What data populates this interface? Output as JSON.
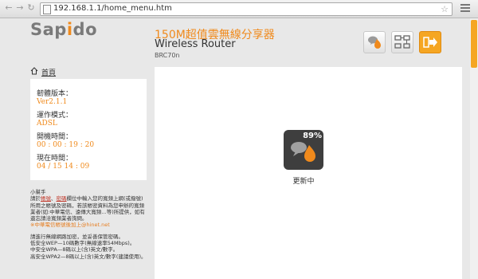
{
  "browser": {
    "url": "192.168.1.1/home_menu.htm",
    "icons": [
      "back-arrow-icon",
      "forward-arrow-icon",
      "reload-icon",
      "page-icon",
      "star-icon",
      "menu-icon"
    ]
  },
  "header": {
    "logo": {
      "pre": "Sap",
      "o": "i",
      "post": "do"
    },
    "product_zh": "150M超值雲無線分享器",
    "product_en": "Wireless Router",
    "model": "BRC70n",
    "accent": "#f08a1c"
  },
  "sidebar": {
    "home_label": "首頁",
    "info": [
      {
        "label": "韌體版本：",
        "value": "Ver2.1.1"
      },
      {
        "label": "運作模式：",
        "value": "ADSL"
      },
      {
        "label": "開機時間：",
        "value": "00 : 00 : 19 : 20"
      },
      {
        "label": "現在時間：",
        "value": "04 / 15  14 : 09"
      }
    ]
  },
  "help": {
    "title": "小幫手",
    "l1_a": "請於",
    "l1_acc": "帳號",
    "l1_b": "、",
    "l1_pwd": "密碼",
    "l1_c": "欄位中輸入您的寬頻上網(或撥號)",
    "l2": "所用之帳號及密碼，若該帳密資料為您申辦的寬頻",
    "l3": "業者(如:中華電信、遠傳大寬頻…等)所提供，如有",
    "l4": "遺忘請洽寬頻業者詢問。",
    "l5": "※中華電信帳號後加上@hinet.net",
    "l6": "請進行無線網路加密，並妥善保管密碼。",
    "l7": "低安全WEP—10碼數字(無線速率54Mbps)。",
    "l8": "中安全WPA—8碼以上(含)英文/數字。",
    "l9": "高安全WPA2—8碼以上(含)英文/數字(建議使用)。"
  },
  "main": {
    "status_percent": "89%",
    "status_label": "更新中"
  }
}
